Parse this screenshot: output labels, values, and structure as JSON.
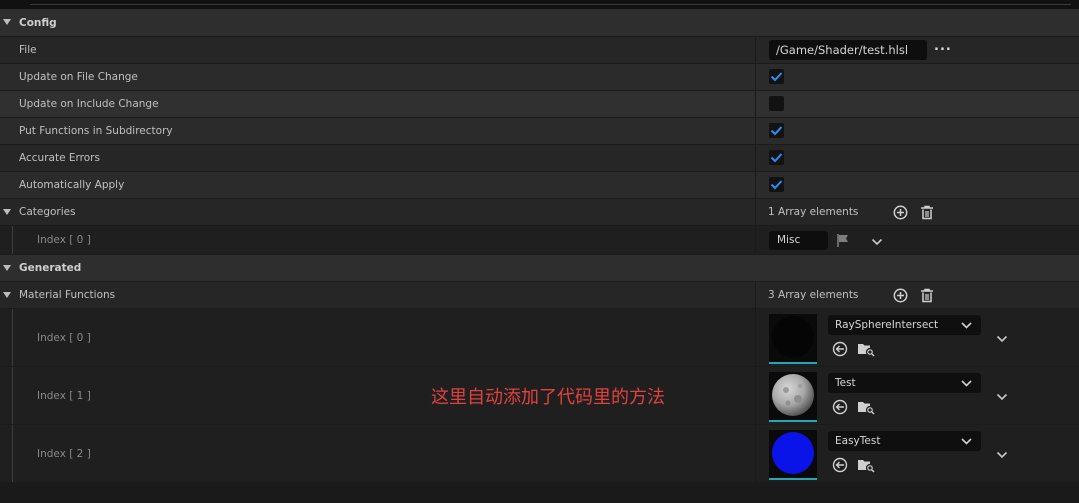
{
  "sections": {
    "config": {
      "label": "Config"
    },
    "generated": {
      "label": "Generated"
    }
  },
  "properties": {
    "file": {
      "label": "File",
      "value": "/Game/Shader/test.hlsl",
      "browse": "..."
    },
    "update_on_file_change": {
      "label": "Update on File Change",
      "checked": true
    },
    "update_on_include_change": {
      "label": "Update on Include Change",
      "checked": false
    },
    "put_functions_in_subdirectory": {
      "label": "Put Functions in Subdirectory",
      "checked": true
    },
    "accurate_errors": {
      "label": "Accurate Errors",
      "checked": true
    },
    "automatically_apply": {
      "label": "Automatically Apply",
      "checked": true
    }
  },
  "categories": {
    "label": "Categories",
    "count": "1 Array elements",
    "items": [
      {
        "index": "Index [ 0 ]",
        "value": "Misc"
      }
    ]
  },
  "material_functions": {
    "label": "Material Functions",
    "count": "3 Array elements",
    "items": [
      {
        "index": "Index [ 0 ]",
        "value": "RaySphereIntersect",
        "thumb": "black-sphere"
      },
      {
        "index": "Index [ 1 ]",
        "value": "Test",
        "thumb": "grey-rocky-sphere"
      },
      {
        "index": "Index [ 2 ]",
        "value": "EasyTest",
        "thumb": "blue-sphere"
      }
    ]
  },
  "annotation": "这里自动添加了代码里的方法",
  "colors": {
    "accent": "#2f8cf5",
    "annotation": "#e0423e",
    "thumb_bar": "#2aa5b5"
  }
}
